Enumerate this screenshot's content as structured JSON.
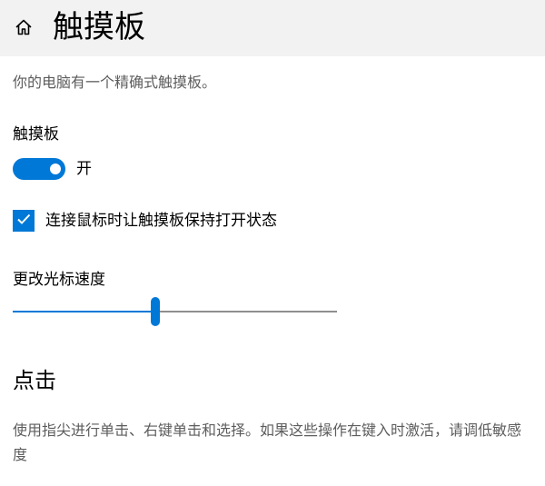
{
  "header": {
    "title": "触摸板",
    "home_icon": "home-icon"
  },
  "description": "你的电脑有一个精确式触摸板。",
  "touchpad": {
    "label": "触摸板",
    "toggle_on": true,
    "state_text": "开"
  },
  "keep_on_with_mouse": {
    "checked": true,
    "label": "连接鼠标时让触摸板保持打开状态"
  },
  "cursor_speed": {
    "label": "更改光标速度",
    "value_fraction": 0.44
  },
  "taps": {
    "heading": "点击",
    "description": "使用指尖进行单击、右键单击和选择。如果这些操作在键入时激活，请调低敏感度"
  },
  "colors": {
    "accent": "#0078d7",
    "header_bg": "#f2f2f2",
    "secondary_text": "#5d5d5d",
    "track_rest": "#8f8f8f"
  }
}
